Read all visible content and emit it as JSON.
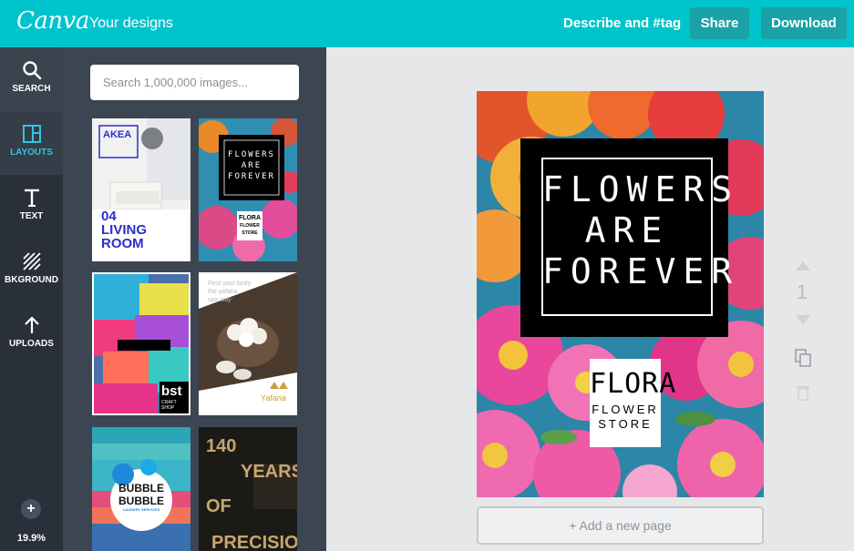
{
  "topbar": {
    "logo": "Canva",
    "your_designs": "Your designs",
    "describe_tag": "Describe and #tag",
    "share": "Share",
    "download": "Download"
  },
  "rail": {
    "items": [
      {
        "label": "SEARCH",
        "icon": "search-icon"
      },
      {
        "label": "LAYOUTS",
        "icon": "layouts-icon"
      },
      {
        "label": "TEXT",
        "icon": "text-icon"
      },
      {
        "label": "BKGROUND",
        "icon": "background-icon"
      },
      {
        "label": "UPLOADS",
        "icon": "upload-icon"
      }
    ],
    "plus": "+",
    "zoom": "19.9%"
  },
  "panel": {
    "search_placeholder": "Search 1,000,000 images...",
    "layouts": [
      {
        "id": "living-room",
        "lines": [
          "AKEA",
          "04",
          "LIVING",
          "ROOM"
        ]
      },
      {
        "id": "flowers-small",
        "lines": [
          "FLOWERS",
          "ARE",
          "FOREVER",
          "FLORA",
          "FLOWER",
          "STORE"
        ]
      },
      {
        "id": "bst",
        "lines": [
          "bst",
          "CRAFT SHOP"
        ]
      },
      {
        "id": "yafana",
        "lines": [
          "Rest your body",
          "the yafana",
          "spa way",
          "Yafana"
        ]
      },
      {
        "id": "bubble",
        "lines": [
          "BUBBLE",
          "BUBBLE",
          "LAUNDRY SERVICES"
        ]
      },
      {
        "id": "years",
        "lines": [
          "140",
          "YEARS",
          "OF",
          "PRECISION"
        ]
      }
    ]
  },
  "design": {
    "headline": [
      "FLOWERS",
      "ARE",
      "FOREVER"
    ],
    "brand": "FLORA",
    "brand_sub1": "FLOWER",
    "brand_sub2": "STORE"
  },
  "workspace": {
    "page_number": "1",
    "add_page": "+ Add a new page"
  },
  "colors": {
    "brand": "#00c4cc",
    "rail": "#293039",
    "panel": "#3c4552",
    "active": "#33c3e0"
  }
}
